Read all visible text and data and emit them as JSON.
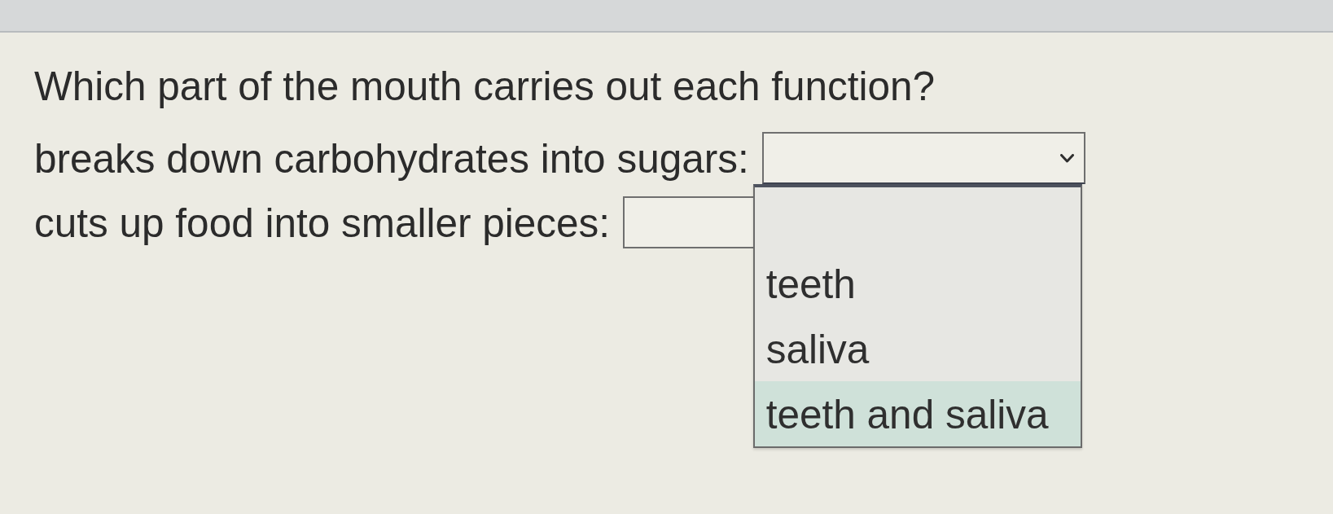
{
  "question": "Which part of the mouth carries out each function?",
  "items": [
    {
      "prompt": "breaks down carbohydrates into sugars:",
      "expanded": true,
      "options": [
        {
          "label": "teeth",
          "selected": false
        },
        {
          "label": "saliva",
          "selected": false
        },
        {
          "label": "teeth and saliva",
          "selected": true
        }
      ]
    },
    {
      "prompt": "cuts up food into smaller pieces:",
      "expanded": false
    }
  ]
}
